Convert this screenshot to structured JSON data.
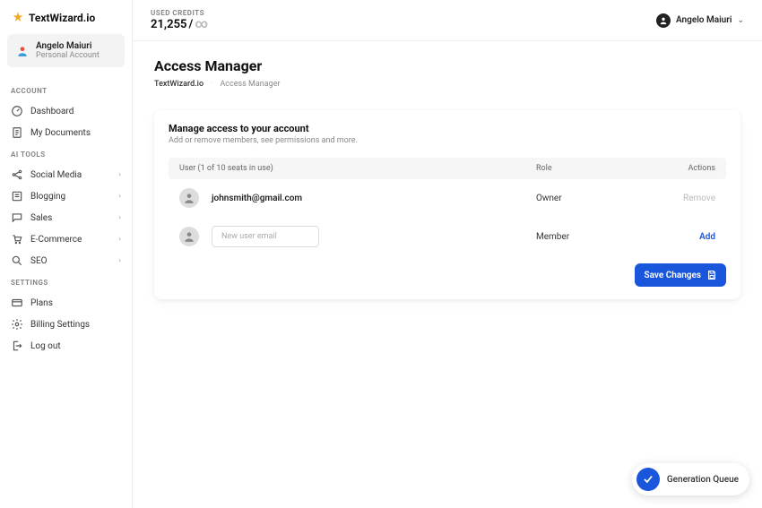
{
  "brand": {
    "name": "TextWizard.io"
  },
  "header": {
    "credits_label": "USED CREDITS",
    "credits_value": "21,255",
    "user_name": "Angelo Maiuri"
  },
  "profile": {
    "name": "Angelo Maiuri",
    "subtitle": "Personal Account"
  },
  "sidebar": {
    "sections": {
      "account": {
        "label": "ACCOUNT",
        "items": [
          "Dashboard",
          "My Documents"
        ]
      },
      "ai_tools": {
        "label": "AI TOOLS",
        "items": [
          "Social Media",
          "Blogging",
          "Sales",
          "E-Commerce",
          "SEO"
        ]
      },
      "settings": {
        "label": "SETTINGS",
        "items": [
          "Plans",
          "Billing Settings",
          "Log out"
        ]
      }
    }
  },
  "page": {
    "title": "Access Manager",
    "breadcrumb_root": "TextWizard.io",
    "breadcrumb_sep": "·",
    "breadcrumb_current": "Access Manager"
  },
  "card": {
    "title": "Manage access to your account",
    "subtitle": "Add or remove members, see permissions and more.",
    "headers": {
      "user": "User (1 of 10 seats in use)",
      "role": "Role",
      "actions": "Actions"
    },
    "rows": [
      {
        "email": "johnsmith@gmail.com",
        "role": "Owner",
        "action": "Remove"
      }
    ],
    "new_row": {
      "placeholder": "New user email",
      "role": "Member",
      "action": "Add"
    },
    "save_label": "Save Changes"
  },
  "fab": {
    "label": "Generation Queue"
  }
}
